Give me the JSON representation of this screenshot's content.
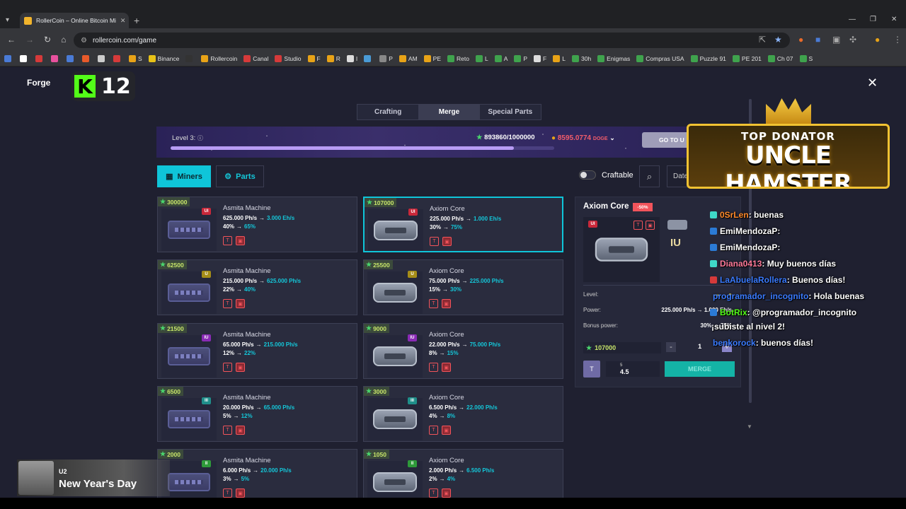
{
  "browser": {
    "tab_title": "RollerCoin – Online Bitcoin Mi",
    "url": "rollercoin.com/game",
    "bookmarks": [
      "",
      "",
      "",
      "",
      "",
      "",
      "",
      "",
      "S",
      "Binance",
      "",
      "Rollercoin",
      "Canal",
      "Studio",
      "F",
      "R",
      "I",
      "",
      "P",
      "AM",
      "PE",
      "Reto",
      "L",
      "A",
      "P",
      "F",
      "L",
      "30h",
      "Enigmas",
      "Compras USA",
      "Puzzle 91",
      "PE 201",
      "Ch 07",
      "S"
    ]
  },
  "header": {
    "title": "Forge",
    "kick_level": "12"
  },
  "tabs": [
    {
      "label": "Crafting",
      "active": false
    },
    {
      "label": "Merge",
      "active": true
    },
    {
      "label": "Special Parts",
      "active": false
    }
  ],
  "level": {
    "label": "Level 3:",
    "xp": "893860/1000000",
    "progress": 0.894,
    "balance": "8595.0774",
    "currency": "DOGE",
    "goto_label": "GO TO U"
  },
  "filters": {
    "miners_label": "Miners",
    "parts_label": "Parts",
    "craftable_label": "Craftable",
    "sort_label": "Date"
  },
  "cards": [
    {
      "price": "300000",
      "name": "Asmita Machine",
      "lvl": "UI",
      "lvl_color": "#c9283a",
      "power_from": "625.000 Ph/s",
      "power_to": "3.000 Eh/s",
      "bonus_from": "40%",
      "bonus_to": "65%",
      "kind": "miner",
      "selected": false
    },
    {
      "price": "62500",
      "name": "Asmita Machine",
      "lvl": "U",
      "lvl_color": "#a58d18",
      "power_from": "215.000 Ph/s",
      "power_to": "625.000 Ph/s",
      "bonus_from": "22%",
      "bonus_to": "40%",
      "kind": "miner",
      "selected": false
    },
    {
      "price": "21500",
      "name": "Asmita Machine",
      "lvl": "IU",
      "lvl_color": "#8a2bb5",
      "power_from": "65.000 Ph/s",
      "power_to": "215.000 Ph/s",
      "bonus_from": "12%",
      "bonus_to": "22%",
      "kind": "miner",
      "selected": false
    },
    {
      "price": "6500",
      "name": "Asmita Machine",
      "lvl": "III",
      "lvl_color": "#1f8f8a",
      "power_from": "20.000 Ph/s",
      "power_to": "65.000 Ph/s",
      "bonus_from": "5%",
      "bonus_to": "12%",
      "kind": "miner",
      "selected": false
    },
    {
      "price": "2000",
      "name": "Asmita Machine",
      "lvl": "II",
      "lvl_color": "#2e9a3a",
      "power_from": "6.000 Ph/s",
      "power_to": "20.000 Ph/s",
      "bonus_from": "3%",
      "bonus_to": "5%",
      "kind": "miner",
      "selected": false
    },
    {
      "price": "107000",
      "name": "Axiom Core",
      "lvl": "UI",
      "lvl_color": "#c9283a",
      "power_from": "225.000 Ph/s",
      "power_to": "1.000 Eh/s",
      "bonus_from": "30%",
      "bonus_to": "75%",
      "kind": "core",
      "selected": true
    },
    {
      "price": "25500",
      "name": "Axiom Core",
      "lvl": "U",
      "lvl_color": "#a58d18",
      "power_from": "75.000 Ph/s",
      "power_to": "225.000 Ph/s",
      "bonus_from": "15%",
      "bonus_to": "30%",
      "kind": "core",
      "selected": false
    },
    {
      "price": "9000",
      "name": "Axiom Core",
      "lvl": "IU",
      "lvl_color": "#8a2bb5",
      "power_from": "22.000 Ph/s",
      "power_to": "75.000 Ph/s",
      "bonus_from": "8%",
      "bonus_to": "15%",
      "kind": "core",
      "selected": false
    },
    {
      "price": "3000",
      "name": "Axiom Core",
      "lvl": "III",
      "lvl_color": "#1f8f8a",
      "power_from": "6.500 Ph/s",
      "power_to": "22.000 Ph/s",
      "bonus_from": "4%",
      "bonus_to": "8%",
      "kind": "core",
      "selected": false
    },
    {
      "price": "1050",
      "name": "Axiom Core",
      "lvl": "II",
      "lvl_color": "#2e9a3a",
      "power_from": "2.000 Ph/s",
      "power_to": "6.500 Ph/s",
      "bonus_from": "2%",
      "bonus_to": "4%",
      "kind": "core",
      "selected": false
    }
  ],
  "detail": {
    "title": "Axiom Core",
    "badge": "-50%",
    "lvl": "UI",
    "part_b": "IU",
    "level_label": "Level:",
    "power_label": "Power:",
    "power_value": "225.000 Ph/s → 1.000 Eh/s",
    "bonus_label": "Bonus power:",
    "bonus_value": "30% → 75%",
    "price": "107000",
    "qty": "1",
    "minus": "-",
    "plus": "+",
    "cost_top": "5",
    "cost_value": "4.5",
    "merge_label": "MERGE"
  },
  "overlay": {
    "donator_top": "TOP DONATOR",
    "donator_name": "UNCLE HAMSTER",
    "chat": [
      {
        "user": "0SrLen",
        "msg": ": buenas",
        "user_color": "#ff8a2a",
        "icon_color": "#3fd9c9"
      },
      {
        "user": "EmiMendozaP",
        "msg": ":",
        "user_color": "#ffffff",
        "icon_color": "#2b7bd6"
      },
      {
        "user": "EmiMendozaP",
        "msg": ":",
        "user_color": "#ffffff",
        "icon_color": "#2b7bd6"
      },
      {
        "user": "Diana0413",
        "msg": ": Muy buenos días",
        "user_color": "#ff7a9a",
        "icon_color": "#3fd9c9"
      },
      {
        "user": "LaAbuelaRollera",
        "msg": ": Buenos días!",
        "user_color": "#3a7bff",
        "icon_color": "#d63a3a"
      },
      {
        "user": "programador_incognito",
        "msg": ": Hola buenas",
        "user_color": "#3a7bff",
        "icon_color": ""
      },
      {
        "user": "BotRix",
        "msg": ": @programador_incognito",
        "user_color": "#53fc18",
        "icon_color": "#2b7bd6"
      },
      {
        "user": "",
        "msg": "¡subiste al nivel 2!",
        "user_color": "#ffffff",
        "icon_color": ""
      },
      {
        "user": "benkorock",
        "msg": ": buenos días!",
        "user_color": "#3a7bff",
        "icon_color": ""
      }
    ]
  },
  "now_playing": {
    "artist": "U2",
    "title": "New Year's Day"
  }
}
